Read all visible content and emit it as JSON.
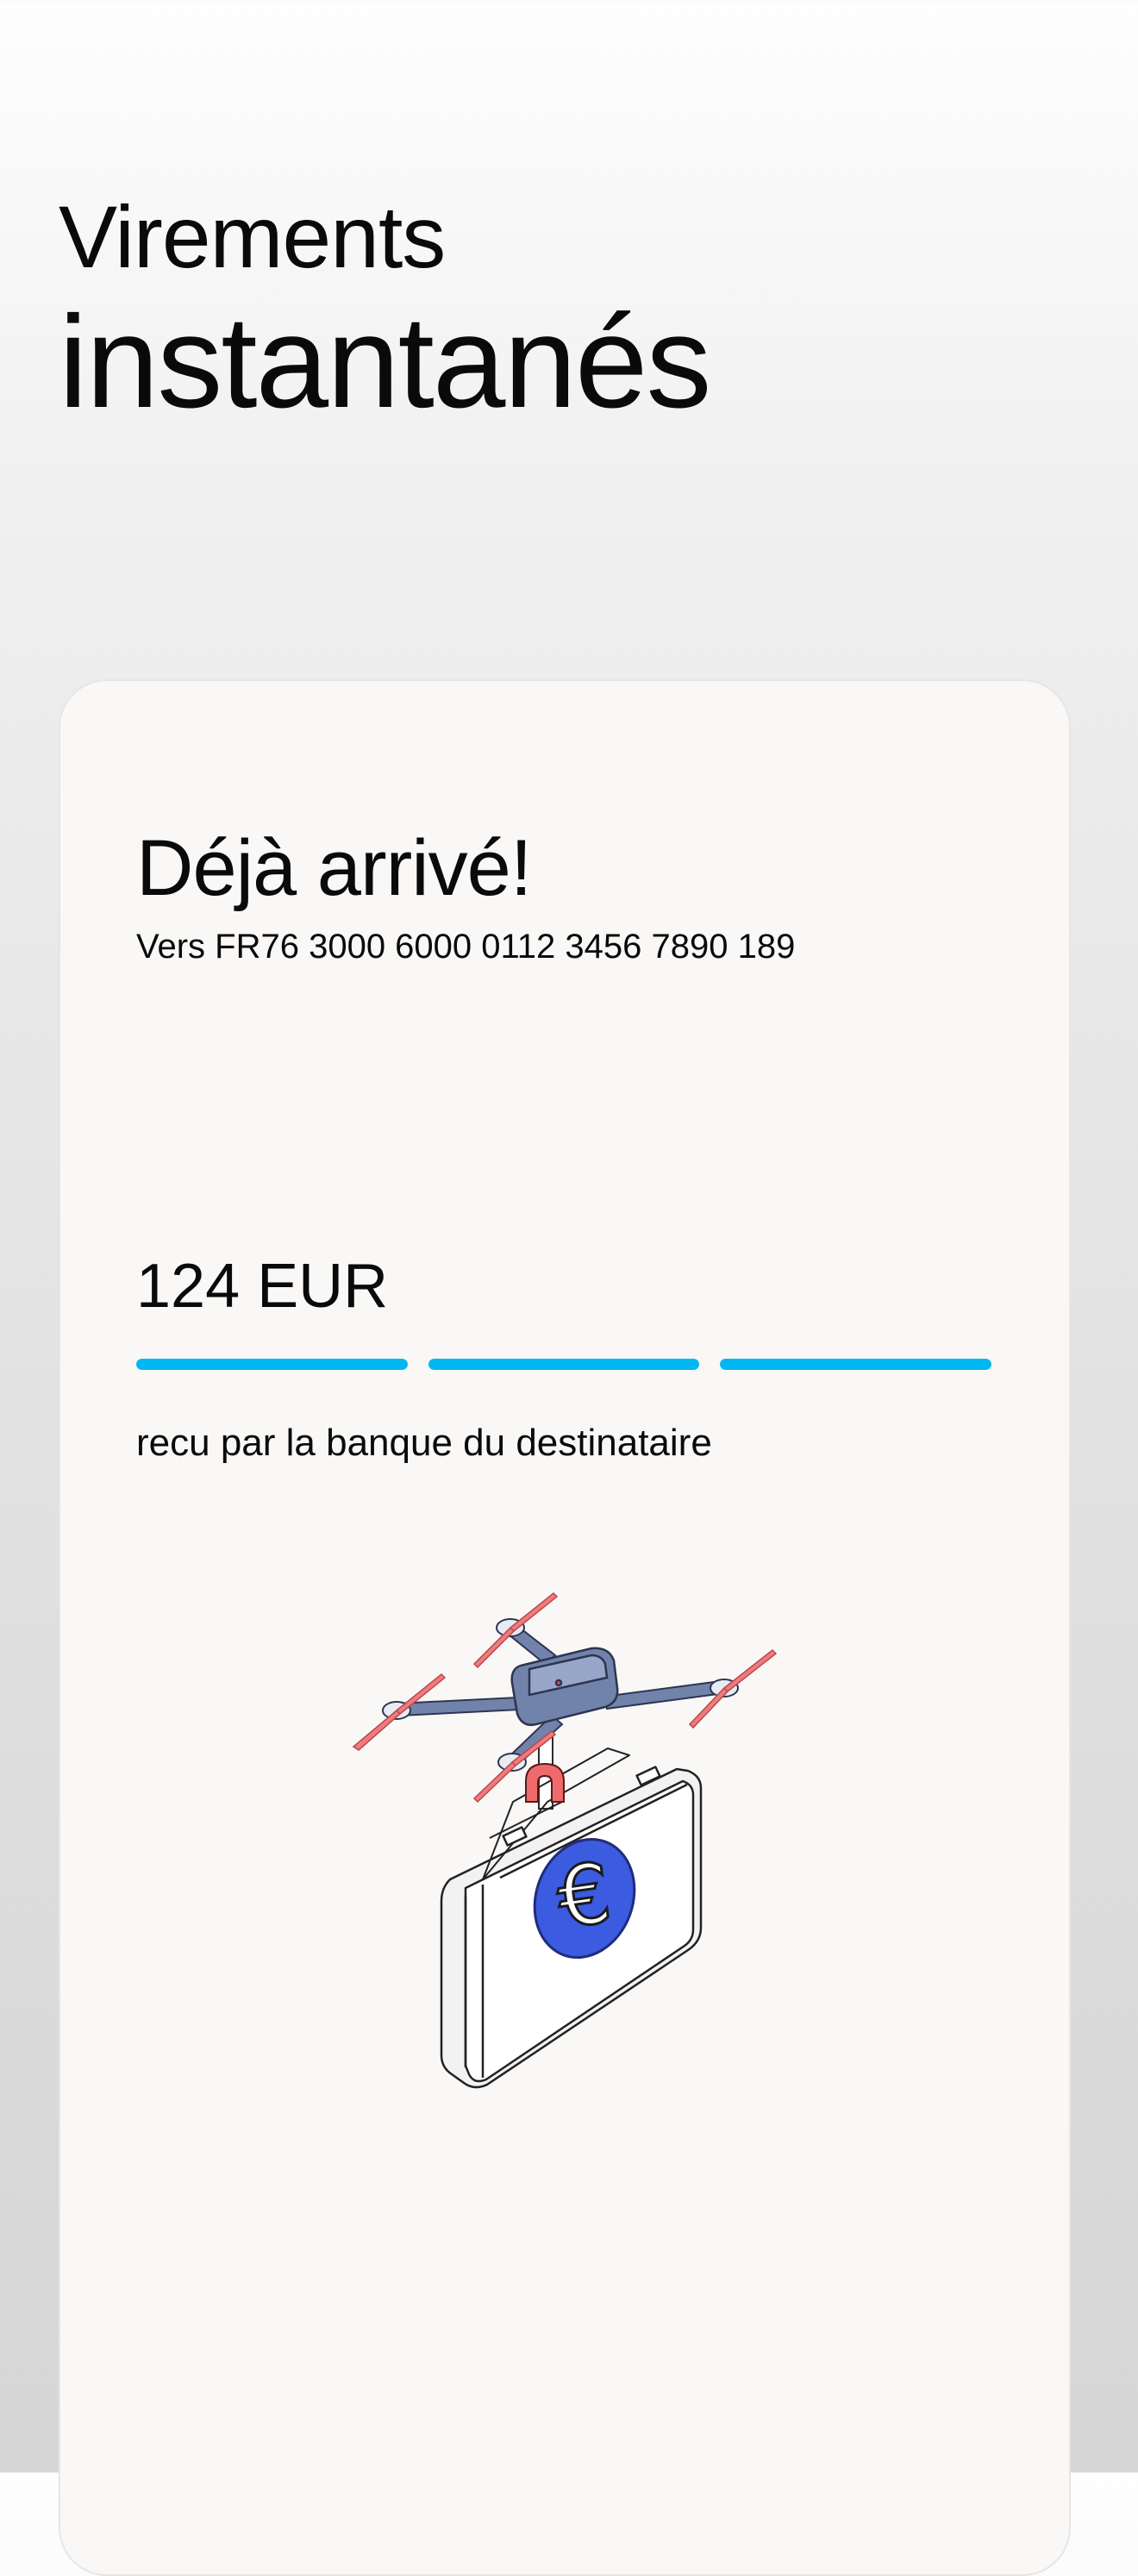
{
  "header": {
    "title_line1": "Virements",
    "title_line2": "instantanés"
  },
  "card": {
    "title": "Déjà arrivé!",
    "iban": "Vers FR76 3000 6000 0112 3456 7890 189",
    "amount": "124 EUR",
    "status": "recu par la banque du destinataire",
    "progress": {
      "steps_total": 3,
      "steps_completed": 3,
      "accent_color": "#00b7f1"
    },
    "illustration": {
      "icon": "drone-delivering-euro-briefcase-icon",
      "colors": {
        "drone_body": "#7183ab",
        "propeller": "#f07a7d",
        "clamp": "#ef6a6c",
        "euro_badge": "#3b5be0"
      }
    }
  }
}
